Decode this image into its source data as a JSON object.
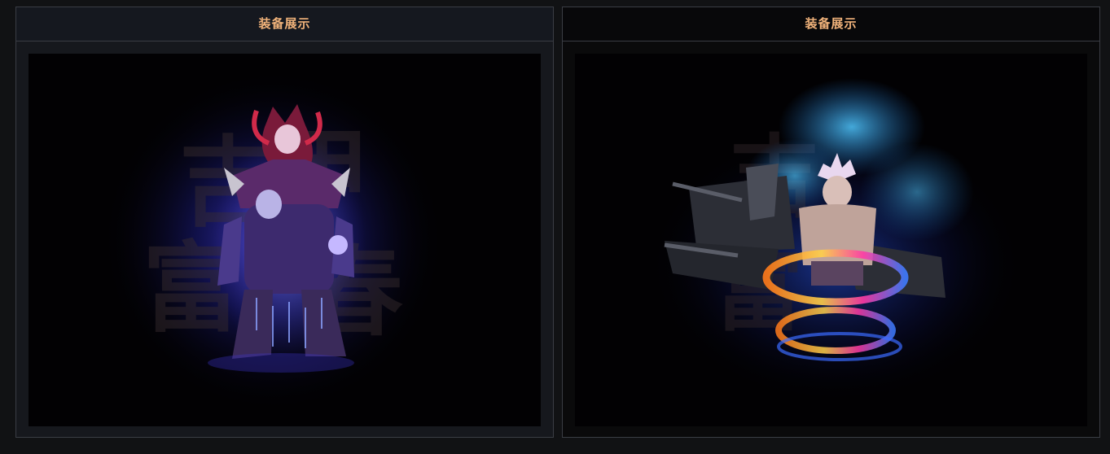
{
  "panels": [
    {
      "title": "装备展示",
      "image_alt": "demon-armor-character"
    },
    {
      "title": "装备展示",
      "image_alt": "winged-warrior-character"
    }
  ],
  "colors": {
    "title": "#f0b27a",
    "border": "#3a3d44",
    "background": "#111214",
    "showcase_bg": "#020103",
    "glow_blue": "#3a5cff",
    "glow_cyan": "#35b7ff"
  }
}
